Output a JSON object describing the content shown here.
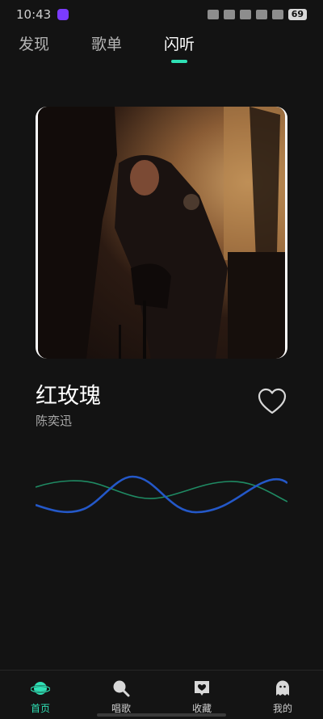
{
  "status": {
    "time": "10:43",
    "battery": "69"
  },
  "tabs": [
    {
      "label": "发现"
    },
    {
      "label": "歌单"
    },
    {
      "label": "闪听"
    }
  ],
  "song": {
    "title": "红玫瑰",
    "artist": "陈奕迅"
  },
  "bottom_nav": [
    {
      "label": "首页"
    },
    {
      "label": "唱歌"
    },
    {
      "label": "收藏"
    },
    {
      "label": "我的"
    }
  ],
  "colors": {
    "accent": "#2fe0b5",
    "wave_blue": "#2458c8",
    "wave_green": "#1f8a63",
    "background": "#131313"
  }
}
